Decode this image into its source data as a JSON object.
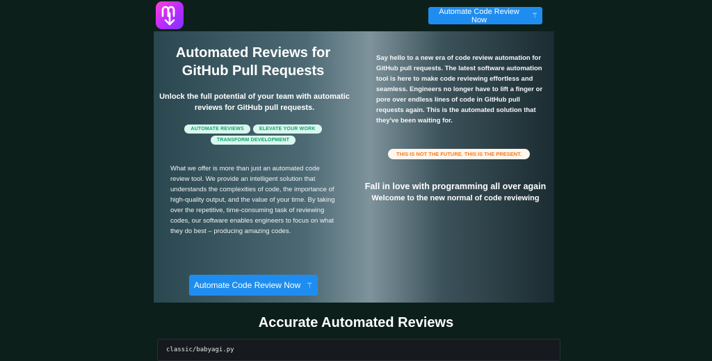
{
  "header": {
    "cta_label": "Automate Code Review Now"
  },
  "hero": {
    "title": "Automated Reviews for GitHub Pull Requests",
    "subtitle": "Unlock the full potential of your team with automatic reviews for GitHub pull requests.",
    "tags": [
      "AUTOMATE REVIEWS",
      "ELEVATE YOUR WORK",
      "TRANSFORM DEVELOPMENT"
    ],
    "description": "What we offer is more than just an automated code review tool. We provide an intelligent solution that understands the complexities of code, the importance of high-quality output, and the value of your time. By taking over the repetitive, time-consuming task of reviewing codes, our software enables engineers to focus on what they do best – producing amazing codes.",
    "cta_label": "Automate Code Review Now",
    "right_text": "Say hello to a new era of code review automation for GitHub pull requests. The latest software automation tool is here to make code reviewing effortless and seamless. Engineers no longer have to lift a finger or pore over endless lines of code in GitHub pull requests again. This is the automated solution that they've been waiting for.",
    "badge": "THIS IS NOT THE FUTURE. THIS IS THE PRESENT.",
    "fall_heading": "Fall in love with programming all over again",
    "welcome": "Welcome to the new normal of code reviewing"
  },
  "section": {
    "title": "Accurate Automated Reviews",
    "code_file": "classic/babyagi.py"
  },
  "colors": {
    "accent": "#1f8df0",
    "background": "#0c1f1a",
    "tag_text": "#12a36b",
    "badge_text": "#f27d21"
  },
  "icons": {
    "logo": "download-arrow-logo-icon",
    "cta": "magic-wand-icon"
  }
}
